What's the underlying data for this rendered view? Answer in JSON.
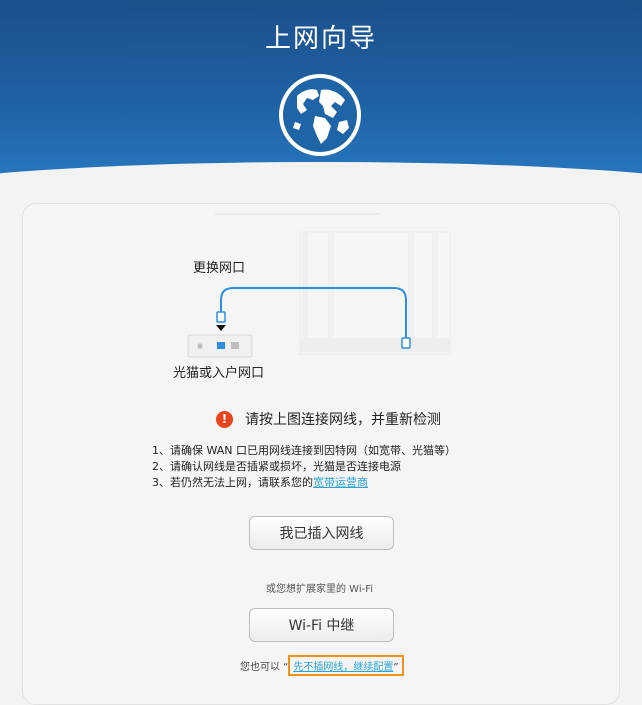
{
  "header": {
    "title": "上网向导"
  },
  "diagram": {
    "replace_port_label": "更换网口",
    "modem_port_label": "光猫或入户网口"
  },
  "warning": {
    "text": "请按上图连接网线，并重新检测",
    "icon": "exclamation-icon",
    "color": "#e8451e"
  },
  "tips": {
    "line1": "1、请确保 WAN 口已用网线连接到因特网（如宽带、光猫等）",
    "line2": "2、请确认网线是否插紧或损坏，光猫是否连接电源",
    "line3_prefix": "3、若仍然无法上网，请联系您的",
    "line3_link": "宽带运营商"
  },
  "buttons": {
    "plugged_in": "我已插入网线",
    "wifi_relay": "Wi-Fi 中继"
  },
  "extend_text": "或您想扩展家里的 Wi-Fi",
  "bottom": {
    "prefix": "您也可以 “",
    "link": "先不插网线，继续配置",
    "suffix": "”"
  },
  "colors": {
    "header": "#1f64a6",
    "accent_link": "#2aa3d6",
    "highlight": "#f0921e",
    "cable": "#2e8fe0"
  }
}
